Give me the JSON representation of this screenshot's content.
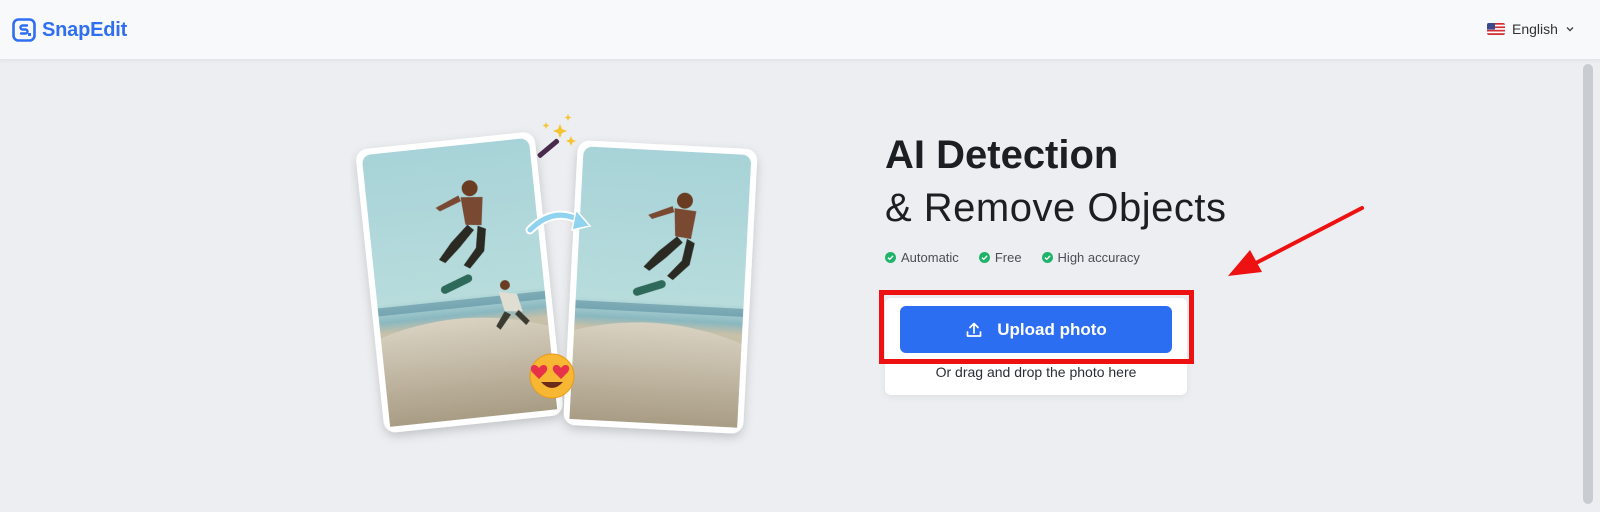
{
  "header": {
    "logo_text": "SnapEdit",
    "language": "English",
    "icons": {
      "logo": "snapedit-logo-icon",
      "flag": "us-flag-icon",
      "chevron": "chevron-down-icon"
    }
  },
  "hero": {
    "title_line1": "AI Detection",
    "title_line2": "& Remove Objects",
    "features": [
      "Automatic",
      "Free",
      "High accuracy"
    ],
    "upload_button": "Upload photo",
    "drag_hint": "Or drag and drop the photo here"
  },
  "colors": {
    "brand": "#2f6ff0",
    "button": "#2c6ef2",
    "check": "#1fb36a",
    "annotation": "#ee1111",
    "background": "#eceef1"
  }
}
